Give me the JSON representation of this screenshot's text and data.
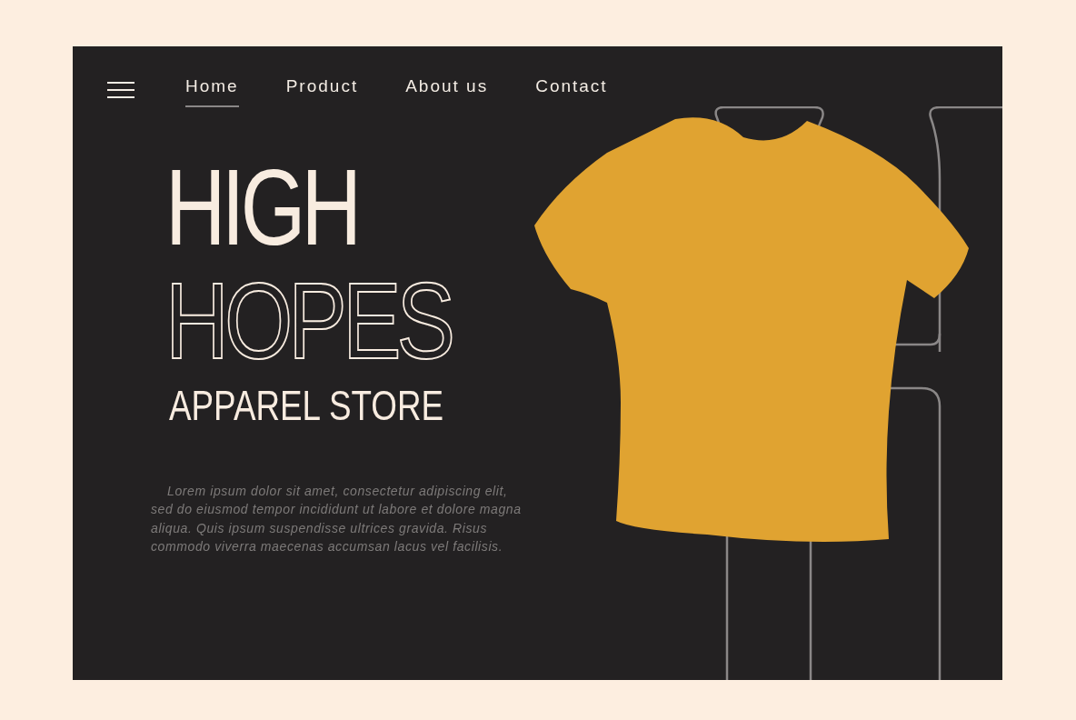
{
  "nav": {
    "items": [
      {
        "label": "Home",
        "selected": true
      },
      {
        "label": "Product",
        "selected": false
      },
      {
        "label": "About us",
        "selected": false
      },
      {
        "label": "Contact",
        "selected": false
      }
    ]
  },
  "hero": {
    "title_line_1": "HIGH",
    "title_line_2": "HOPES",
    "subtitle": "APPAREL STORE",
    "description": "Lorem ipsum dolor sit amet, consectetur adipiscing elit, sed do eiusmod tempor incididunt ut labore et dolore magna aliqua. Quis ipsum suspendisse ultrices gravida. Risus commodo viverra maecenas accumsan lacus vel facilisis."
  }
}
